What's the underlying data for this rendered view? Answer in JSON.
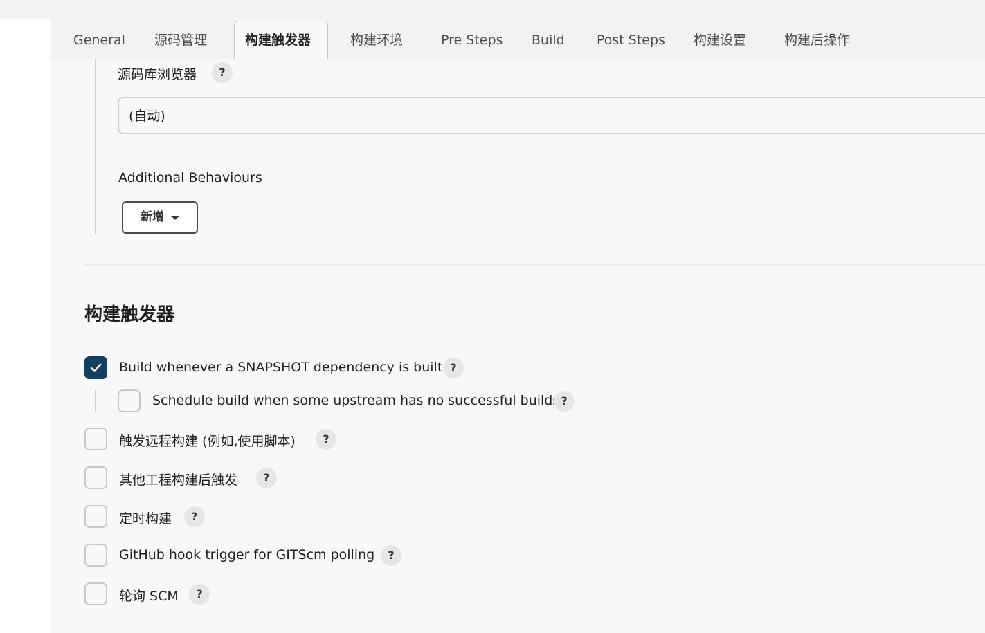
{
  "tabs": [
    {
      "label": "General",
      "active": false
    },
    {
      "label": "源码管理",
      "active": false
    },
    {
      "label": "构建触发器",
      "active": true
    },
    {
      "label": "构建环境",
      "active": false
    },
    {
      "label": "Pre Steps",
      "active": false
    },
    {
      "label": "Build",
      "active": false
    },
    {
      "label": "Post Steps",
      "active": false
    },
    {
      "label": "构建设置",
      "active": false
    },
    {
      "label": "构建后操作",
      "active": false
    }
  ],
  "scm": {
    "repo_browser_label": "源码库浏览器",
    "repo_browser_value": "(自动)",
    "additional_behaviours_label": "Additional Behaviours",
    "add_button_label": "新增"
  },
  "help_glyph": "?",
  "triggers": {
    "title": "构建触发器",
    "items": [
      {
        "label": "Build whenever a SNAPSHOT dependency is built",
        "checked": true
      },
      {
        "label": "Schedule build when some upstream has no successful builds",
        "checked": false
      },
      {
        "label": "触发远程构建 (例如,使用脚本)",
        "checked": false
      },
      {
        "label": "其他工程构建后触发",
        "checked": false
      },
      {
        "label": "定时构建",
        "checked": false
      },
      {
        "label": "GitHub hook trigger for GITScm polling",
        "checked": false
      },
      {
        "label": "轮询 SCM",
        "checked": false
      }
    ]
  },
  "colors": {
    "checkbox_checked": "#0f3f63",
    "background": "#f8f8f8"
  }
}
